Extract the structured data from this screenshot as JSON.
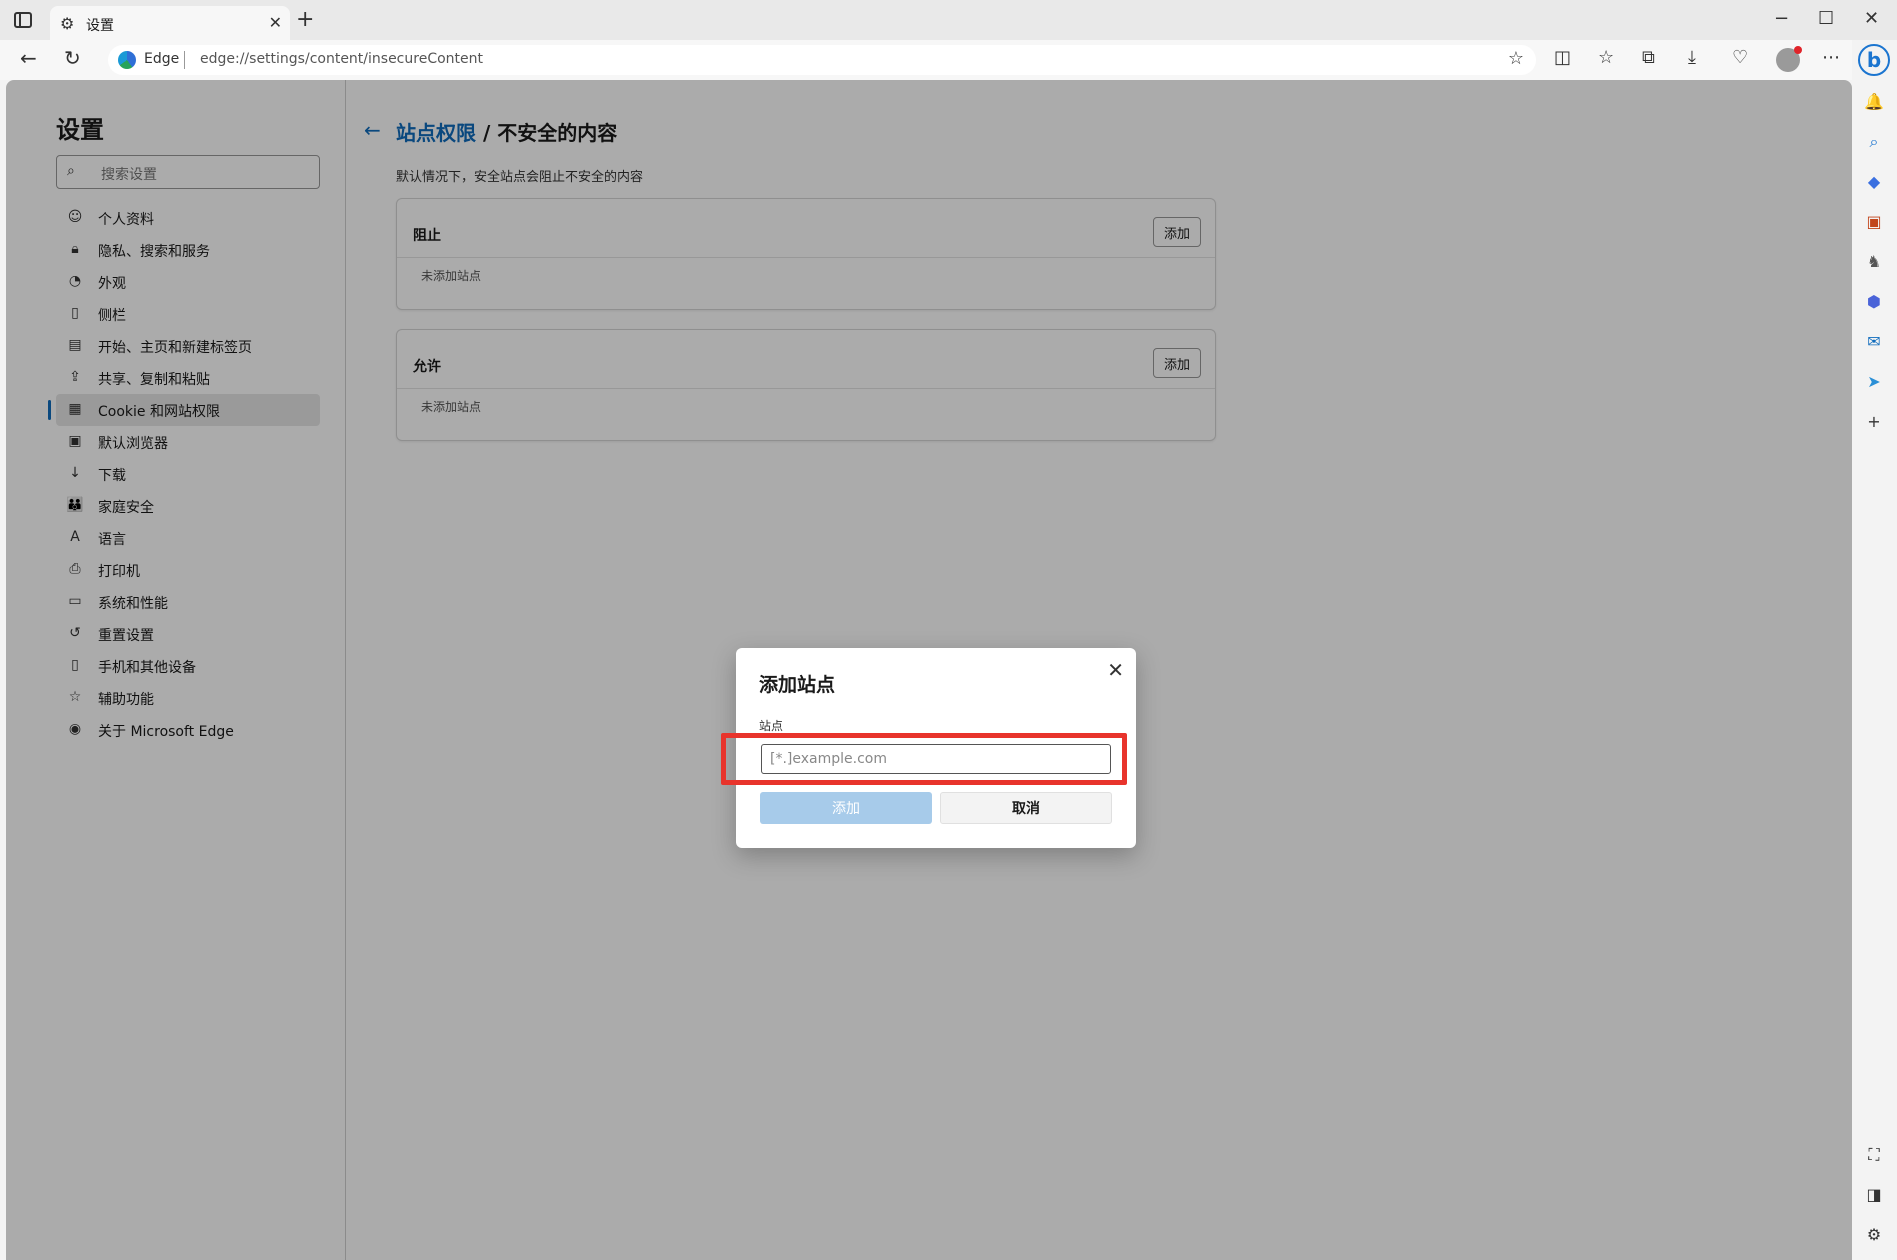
{
  "browser": {
    "tab_title": "设置",
    "brand": "Edge",
    "url": "edge://settings/content/insecureContent"
  },
  "settings": {
    "title": "设置",
    "search_placeholder": "搜索设置",
    "nav": [
      {
        "label": "个人资料",
        "icon": "profile-icon",
        "active": false
      },
      {
        "label": "隐私、搜索和服务",
        "icon": "lock-icon",
        "active": false
      },
      {
        "label": "外观",
        "icon": "appearance-icon",
        "active": false
      },
      {
        "label": "侧栏",
        "icon": "sidebar-icon",
        "active": false
      },
      {
        "label": "开始、主页和新建标签页",
        "icon": "home-icon",
        "active": false
      },
      {
        "label": "共享、复制和粘贴",
        "icon": "share-icon",
        "active": false
      },
      {
        "label": "Cookie 和网站权限",
        "icon": "cookie-icon",
        "active": true
      },
      {
        "label": "默认浏览器",
        "icon": "browser-icon",
        "active": false
      },
      {
        "label": "下载",
        "icon": "download-icon",
        "active": false
      },
      {
        "label": "家庭安全",
        "icon": "family-icon",
        "active": false
      },
      {
        "label": "语言",
        "icon": "language-icon",
        "active": false
      },
      {
        "label": "打印机",
        "icon": "printer-icon",
        "active": false
      },
      {
        "label": "系统和性能",
        "icon": "system-icon",
        "active": false
      },
      {
        "label": "重置设置",
        "icon": "reset-icon",
        "active": false
      },
      {
        "label": "手机和其他设备",
        "icon": "phone-icon",
        "active": false
      },
      {
        "label": "辅助功能",
        "icon": "accessibility-icon",
        "active": false
      },
      {
        "label": "关于 Microsoft Edge",
        "icon": "edge-logo-icon",
        "active": false
      }
    ]
  },
  "page": {
    "breadcrumb_link": "站点权限",
    "breadcrumb_sep": " / ",
    "breadcrumb_current": "不安全的内容",
    "description": "默认情况下，安全站点会阻止不安全的内容",
    "block": {
      "title": "阻止",
      "add_label": "添加",
      "empty": "未添加站点"
    },
    "allow": {
      "title": "允许",
      "add_label": "添加",
      "empty": "未添加站点"
    }
  },
  "dialog": {
    "title": "添加站点",
    "field_label": "站点",
    "placeholder": "[*.]example.com",
    "add_label": "添加",
    "cancel_label": "取消"
  },
  "colors": {
    "accent": "#0f6cbd",
    "highlight": "#e8342c",
    "disabled_button": "#a7cbea"
  }
}
